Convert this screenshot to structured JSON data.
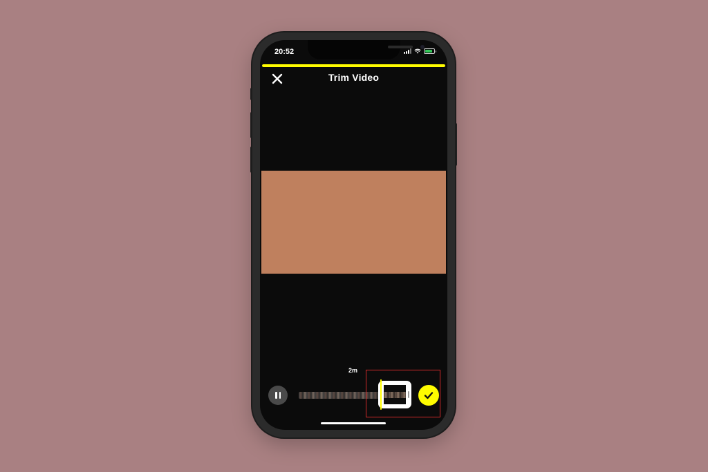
{
  "status_bar": {
    "time": "20:52",
    "icons": [
      "signal-icon",
      "wifi-icon",
      "battery-charging-icon"
    ]
  },
  "story_progress": {
    "fraction": 1.0,
    "color": "#fffc00"
  },
  "header": {
    "title": "Trim Video",
    "close_icon": "close-icon"
  },
  "video_preview": {
    "color": "#bf805e"
  },
  "trim_controls": {
    "duration_label": "2m",
    "pause_icon": "pause-icon",
    "done_icon": "checkmark-icon",
    "accent_color": "#fffc00"
  },
  "annotation": {
    "highlight_color": "#d22a2a"
  },
  "colors": {
    "background": "#a98082",
    "screen": "#0b0b0b",
    "accent": "#fffc00"
  }
}
